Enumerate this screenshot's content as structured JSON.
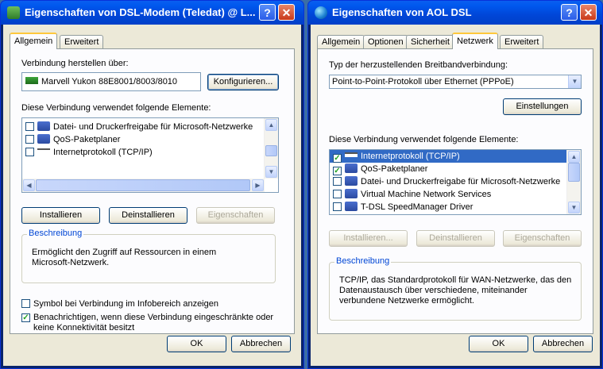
{
  "left": {
    "title": "Eigenschaften von DSL-Modem (Teledat) @ L...",
    "tabs": [
      "Allgemein",
      "Erweitert"
    ],
    "connect_via_label": "Verbindung herstellen über:",
    "adapter_name": "Marvell Yukon 88E8001/8003/8010",
    "configure_button": "Konfigurieren...",
    "elements_label": "Diese Verbindung verwendet folgende Elemente:",
    "items": [
      {
        "label": "Datei- und Druckerfreigabe für Microsoft-Netzwerke",
        "checked": false
      },
      {
        "label": "QoS-Paketplaner",
        "checked": false
      },
      {
        "label": "Internetprotokoll (TCP/IP)",
        "checked": false
      }
    ],
    "install_button": "Installieren",
    "uninstall_button": "Deinstallieren",
    "properties_button": "Eigenschaften",
    "description_legend": "Beschreibung",
    "description_text": "Ermöglicht den Zugriff auf Ressourcen in einem Microsoft-Netzwerk.",
    "show_icon_label": "Symbol bei Verbindung im Infobereich anzeigen",
    "show_icon_checked": false,
    "notify_label": "Benachrichtigen, wenn diese Verbindung eingeschränkte oder keine Konnektivität besitzt",
    "notify_checked": true,
    "ok_button": "OK",
    "cancel_button": "Abbrechen"
  },
  "right": {
    "title": "Eigenschaften von AOL DSL",
    "tabs": [
      "Allgemein",
      "Optionen",
      "Sicherheit",
      "Netzwerk",
      "Erweitert"
    ],
    "type_label": "Typ der herzustellenden Breitbandverbindung:",
    "type_value": "Point-to-Point-Protokoll über Ethernet (PPPoE)",
    "settings_button": "Einstellungen",
    "elements_label": "Diese Verbindung verwendet folgende Elemente:",
    "items": [
      {
        "label": "Internetprotokoll (TCP/IP)",
        "checked": true
      },
      {
        "label": "QoS-Paketplaner",
        "checked": true
      },
      {
        "label": "Datei- und Druckerfreigabe für Microsoft-Netzwerke",
        "checked": false
      },
      {
        "label": "Virtual Machine Network Services",
        "checked": false
      },
      {
        "label": "T-DSL SpeedManager Driver",
        "checked": false
      }
    ],
    "install_button": "Installieren...",
    "uninstall_button": "Deinstallieren",
    "properties_button": "Eigenschaften",
    "description_legend": "Beschreibung",
    "description_text": "TCP/IP, das Standardprotokoll für WAN-Netzwerke, das den Datenaustausch über verschiedene, miteinander verbundene Netzwerke ermöglicht.",
    "ok_button": "OK",
    "cancel_button": "Abbrechen"
  },
  "icons": {
    "help": "?",
    "close": "✕",
    "check": "✓",
    "arrow_up": "▲",
    "arrow_down": "▼",
    "arrow_left": "◀",
    "arrow_right": "▶",
    "combo_arrow": "▼"
  },
  "colors": {
    "titlebar": "#0058ee",
    "dialog_bg": "#ece9d8",
    "selection": "#316ac5",
    "group_legend": "#0046d5"
  }
}
